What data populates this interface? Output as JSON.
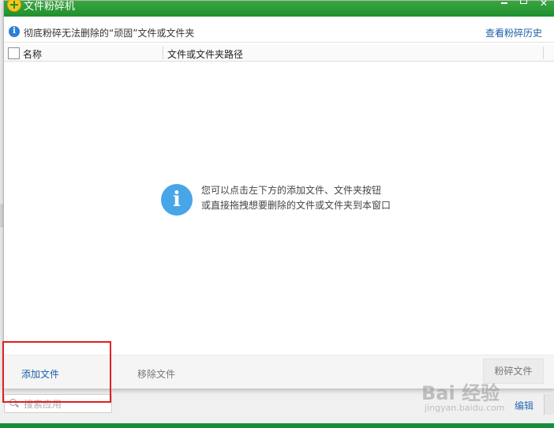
{
  "window": {
    "title": "文件粉碎机"
  },
  "infobar": {
    "text": "彻底粉碎无法删除的“顽固”文件或文件夹",
    "history_link": "查看粉碎历史"
  },
  "table": {
    "columns": [
      "名称",
      "文件或文件夹路径"
    ]
  },
  "empty_state": {
    "line1": "您可以点击左下方的添加文件、文件夹按钮",
    "line2": "或直接拖拽想要删除的文件或文件夹到本窗口"
  },
  "footer": {
    "add_label": "添加文件",
    "remove_label": "移除文件",
    "shred_label": "粉碎文件"
  },
  "background": {
    "search_placeholder": "搜索应用",
    "edit_label": "编辑"
  },
  "watermark": {
    "main": "Bai 经验",
    "sub": "jingyan.baidu.com"
  },
  "colors": {
    "titlebar": "#2a9a36",
    "link": "#1d5fa8",
    "info_icon": "#48a5e8",
    "highlight": "#e02020"
  }
}
